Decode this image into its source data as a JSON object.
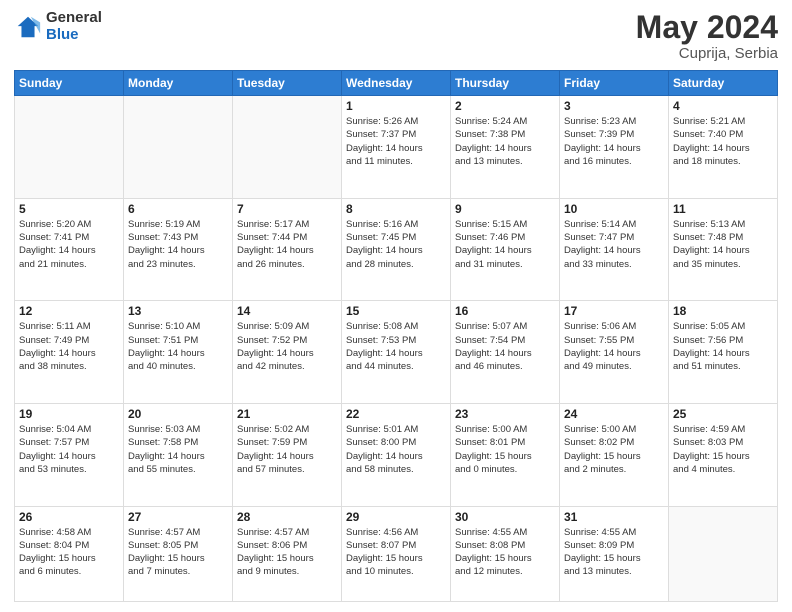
{
  "header": {
    "logo_general": "General",
    "logo_blue": "Blue",
    "month_year": "May 2024",
    "location": "Cuprija, Serbia"
  },
  "weekdays": [
    "Sunday",
    "Monday",
    "Tuesday",
    "Wednesday",
    "Thursday",
    "Friday",
    "Saturday"
  ],
  "weeks": [
    [
      {
        "day": "",
        "info": ""
      },
      {
        "day": "",
        "info": ""
      },
      {
        "day": "",
        "info": ""
      },
      {
        "day": "1",
        "info": "Sunrise: 5:26 AM\nSunset: 7:37 PM\nDaylight: 14 hours\nand 11 minutes."
      },
      {
        "day": "2",
        "info": "Sunrise: 5:24 AM\nSunset: 7:38 PM\nDaylight: 14 hours\nand 13 minutes."
      },
      {
        "day": "3",
        "info": "Sunrise: 5:23 AM\nSunset: 7:39 PM\nDaylight: 14 hours\nand 16 minutes."
      },
      {
        "day": "4",
        "info": "Sunrise: 5:21 AM\nSunset: 7:40 PM\nDaylight: 14 hours\nand 18 minutes."
      }
    ],
    [
      {
        "day": "5",
        "info": "Sunrise: 5:20 AM\nSunset: 7:41 PM\nDaylight: 14 hours\nand 21 minutes."
      },
      {
        "day": "6",
        "info": "Sunrise: 5:19 AM\nSunset: 7:43 PM\nDaylight: 14 hours\nand 23 minutes."
      },
      {
        "day": "7",
        "info": "Sunrise: 5:17 AM\nSunset: 7:44 PM\nDaylight: 14 hours\nand 26 minutes."
      },
      {
        "day": "8",
        "info": "Sunrise: 5:16 AM\nSunset: 7:45 PM\nDaylight: 14 hours\nand 28 minutes."
      },
      {
        "day": "9",
        "info": "Sunrise: 5:15 AM\nSunset: 7:46 PM\nDaylight: 14 hours\nand 31 minutes."
      },
      {
        "day": "10",
        "info": "Sunrise: 5:14 AM\nSunset: 7:47 PM\nDaylight: 14 hours\nand 33 minutes."
      },
      {
        "day": "11",
        "info": "Sunrise: 5:13 AM\nSunset: 7:48 PM\nDaylight: 14 hours\nand 35 minutes."
      }
    ],
    [
      {
        "day": "12",
        "info": "Sunrise: 5:11 AM\nSunset: 7:49 PM\nDaylight: 14 hours\nand 38 minutes."
      },
      {
        "day": "13",
        "info": "Sunrise: 5:10 AM\nSunset: 7:51 PM\nDaylight: 14 hours\nand 40 minutes."
      },
      {
        "day": "14",
        "info": "Sunrise: 5:09 AM\nSunset: 7:52 PM\nDaylight: 14 hours\nand 42 minutes."
      },
      {
        "day": "15",
        "info": "Sunrise: 5:08 AM\nSunset: 7:53 PM\nDaylight: 14 hours\nand 44 minutes."
      },
      {
        "day": "16",
        "info": "Sunrise: 5:07 AM\nSunset: 7:54 PM\nDaylight: 14 hours\nand 46 minutes."
      },
      {
        "day": "17",
        "info": "Sunrise: 5:06 AM\nSunset: 7:55 PM\nDaylight: 14 hours\nand 49 minutes."
      },
      {
        "day": "18",
        "info": "Sunrise: 5:05 AM\nSunset: 7:56 PM\nDaylight: 14 hours\nand 51 minutes."
      }
    ],
    [
      {
        "day": "19",
        "info": "Sunrise: 5:04 AM\nSunset: 7:57 PM\nDaylight: 14 hours\nand 53 minutes."
      },
      {
        "day": "20",
        "info": "Sunrise: 5:03 AM\nSunset: 7:58 PM\nDaylight: 14 hours\nand 55 minutes."
      },
      {
        "day": "21",
        "info": "Sunrise: 5:02 AM\nSunset: 7:59 PM\nDaylight: 14 hours\nand 57 minutes."
      },
      {
        "day": "22",
        "info": "Sunrise: 5:01 AM\nSunset: 8:00 PM\nDaylight: 14 hours\nand 58 minutes."
      },
      {
        "day": "23",
        "info": "Sunrise: 5:00 AM\nSunset: 8:01 PM\nDaylight: 15 hours\nand 0 minutes."
      },
      {
        "day": "24",
        "info": "Sunrise: 5:00 AM\nSunset: 8:02 PM\nDaylight: 15 hours\nand 2 minutes."
      },
      {
        "day": "25",
        "info": "Sunrise: 4:59 AM\nSunset: 8:03 PM\nDaylight: 15 hours\nand 4 minutes."
      }
    ],
    [
      {
        "day": "26",
        "info": "Sunrise: 4:58 AM\nSunset: 8:04 PM\nDaylight: 15 hours\nand 6 minutes."
      },
      {
        "day": "27",
        "info": "Sunrise: 4:57 AM\nSunset: 8:05 PM\nDaylight: 15 hours\nand 7 minutes."
      },
      {
        "day": "28",
        "info": "Sunrise: 4:57 AM\nSunset: 8:06 PM\nDaylight: 15 hours\nand 9 minutes."
      },
      {
        "day": "29",
        "info": "Sunrise: 4:56 AM\nSunset: 8:07 PM\nDaylight: 15 hours\nand 10 minutes."
      },
      {
        "day": "30",
        "info": "Sunrise: 4:55 AM\nSunset: 8:08 PM\nDaylight: 15 hours\nand 12 minutes."
      },
      {
        "day": "31",
        "info": "Sunrise: 4:55 AM\nSunset: 8:09 PM\nDaylight: 15 hours\nand 13 minutes."
      },
      {
        "day": "",
        "info": ""
      }
    ]
  ]
}
